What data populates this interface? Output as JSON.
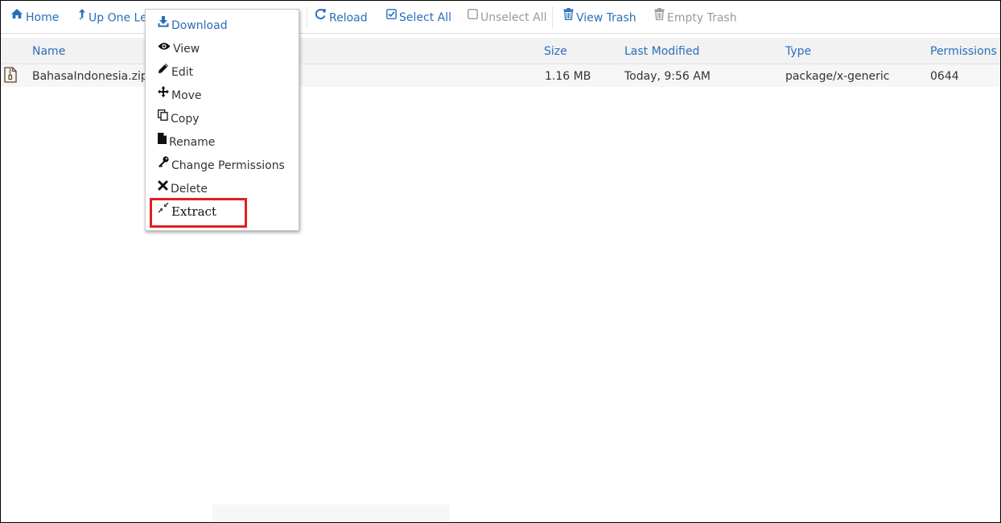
{
  "toolbar": {
    "home": "Home",
    "up_one_level": "Up One Le",
    "reload": "Reload",
    "select_all": "Select All",
    "unselect_all": "Unselect All",
    "view_trash": "View Trash",
    "empty_trash": "Empty Trash"
  },
  "table": {
    "columns": {
      "name": "Name",
      "size": "Size",
      "last_modified": "Last Modified",
      "type": "Type",
      "permissions": "Permissions"
    },
    "rows": [
      {
        "name": "BahasaIndonesia.zip",
        "size": "1.16 MB",
        "last_modified": "Today, 9:56 AM",
        "type": "package/x-generic",
        "permissions": "0644"
      }
    ]
  },
  "context_menu": {
    "download": "Download",
    "view": "View",
    "edit": "Edit",
    "move": "Move",
    "copy": "Copy",
    "rename": "Rename",
    "change_permissions": "Change Permissions",
    "delete": "Delete",
    "extract": "Extract"
  },
  "colors": {
    "link_blue": "#2a6ebb",
    "disabled_gray": "#999999",
    "highlight_red": "#e02020",
    "header_bg": "#f2f2f2"
  },
  "icons": {
    "home": "home-icon",
    "up": "level-up-icon",
    "reload": "reload-icon",
    "select_all": "checked-box-icon",
    "unselect_all": "empty-box-icon",
    "view_trash": "trash-icon",
    "empty_trash": "trash-icon",
    "file": "zip-file-icon",
    "download": "download-icon",
    "view": "eye-icon",
    "edit": "pencil-icon",
    "move": "move-arrows-icon",
    "copy": "copy-icon",
    "rename": "file-icon",
    "change_permissions": "key-icon",
    "delete": "x-icon",
    "extract": "compress-icon"
  }
}
